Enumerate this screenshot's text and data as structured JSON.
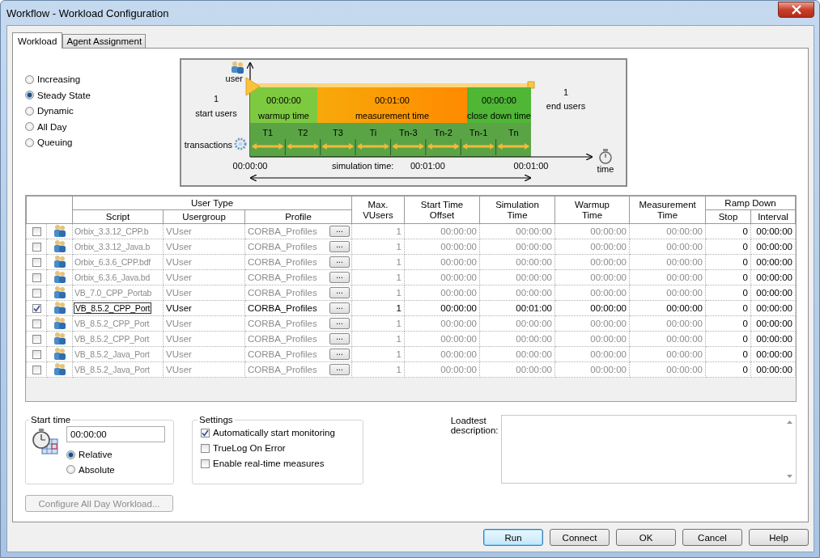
{
  "window": {
    "title": "Workflow - Workload Configuration"
  },
  "tabs": [
    {
      "label": "Workload",
      "selected": true
    },
    {
      "label": "Agent Assignment",
      "selected": false
    }
  ],
  "workload_types": [
    {
      "label": "Increasing",
      "selected": false
    },
    {
      "label": "Steady State",
      "selected": true
    },
    {
      "label": "Dynamic",
      "selected": false
    },
    {
      "label": "All Day",
      "selected": false
    },
    {
      "label": "Queuing",
      "selected": false
    }
  ],
  "diagram": {
    "user_label": "user",
    "start_users": "1",
    "start_users_label": "start users",
    "end_users": "1",
    "end_users_label": "end users",
    "phases": [
      {
        "kind": "warmup",
        "time": "00:00:00",
        "label": "warmup time"
      },
      {
        "kind": "measurement",
        "time": "00:01:00",
        "label": "measurement time"
      },
      {
        "kind": "closedown",
        "time": "00:00:00",
        "label": "close down time"
      }
    ],
    "transactions_label": "transactions",
    "transactions": [
      "T1",
      "T2",
      "T3",
      "Ti",
      "Tn-3",
      "Tn-2",
      "Tn-1",
      "Tn"
    ],
    "start_time": "00:00:00",
    "simulation_label": "simulation time:",
    "simulation_time": "00:01:00",
    "end_time": "00:01:00",
    "time_label": "time"
  },
  "table": {
    "user_type_header": "User Type",
    "user_type_columns": [
      "Script",
      "Usergroup",
      "Profile"
    ],
    "columns": [
      "Max. VUsers",
      "Start Time Offset",
      "Simulation Time",
      "Warmup Time",
      "Measurement Time"
    ],
    "ramp_down_header": "Ramp Down",
    "ramp_down_columns": [
      "Stop",
      "Interval"
    ],
    "rows": [
      {
        "checked": false,
        "selected": false,
        "script": "Orbix_3.3.12_CPP.b",
        "usergroup": "VUser",
        "profile": "CORBA_Profiles",
        "profile_button": "...",
        "values": [
          "1",
          "00:00:00",
          "00:00:00",
          "00:00:00",
          "00:00:00"
        ],
        "stop": "0",
        "interval": "00:00:00"
      },
      {
        "checked": false,
        "selected": false,
        "script": "Orbix_3.3.12_Java.b",
        "usergroup": "VUser",
        "profile": "CORBA_Profiles",
        "profile_button": "...",
        "values": [
          "1",
          "00:00:00",
          "00:00:00",
          "00:00:00",
          "00:00:00"
        ],
        "stop": "0",
        "interval": "00:00:00"
      },
      {
        "checked": false,
        "selected": false,
        "script": "Orbix_6.3.6_CPP.bdf",
        "usergroup": "VUser",
        "profile": "CORBA_Profiles",
        "profile_button": "...",
        "values": [
          "1",
          "00:00:00",
          "00:00:00",
          "00:00:00",
          "00:00:00"
        ],
        "stop": "0",
        "interval": "00:00:00"
      },
      {
        "checked": false,
        "selected": false,
        "script": "Orbix_6.3.6_Java.bd",
        "usergroup": "VUser",
        "profile": "CORBA_Profiles",
        "profile_button": "...",
        "values": [
          "1",
          "00:00:00",
          "00:00:00",
          "00:00:00",
          "00:00:00"
        ],
        "stop": "0",
        "interval": "00:00:00"
      },
      {
        "checked": false,
        "selected": false,
        "script": "VB_7.0_CPP_Portab",
        "usergroup": "VUser",
        "profile": "CORBA_Profiles",
        "profile_button": "...",
        "values": [
          "1",
          "00:00:00",
          "00:00:00",
          "00:00:00",
          "00:00:00"
        ],
        "stop": "0",
        "interval": "00:00:00"
      },
      {
        "checked": true,
        "selected": true,
        "script": "VB_8.5.2_CPP_Port",
        "usergroup": "VUser",
        "profile": "CORBA_Profiles",
        "profile_button": "...",
        "values": [
          "1",
          "00:00:00",
          "00:01:00",
          "00:00:00",
          "00:00:00"
        ],
        "stop": "0",
        "interval": "00:00:00"
      },
      {
        "checked": false,
        "selected": false,
        "script": "VB_8.5.2_CPP_Port",
        "usergroup": "VUser",
        "profile": "CORBA_Profiles",
        "profile_button": "...",
        "values": [
          "1",
          "00:00:00",
          "00:00:00",
          "00:00:00",
          "00:00:00"
        ],
        "stop": "0",
        "interval": "00:00:00"
      },
      {
        "checked": false,
        "selected": false,
        "script": "VB_8.5.2_CPP_Port",
        "usergroup": "VUser",
        "profile": "CORBA_Profiles",
        "profile_button": "...",
        "values": [
          "1",
          "00:00:00",
          "00:00:00",
          "00:00:00",
          "00:00:00"
        ],
        "stop": "0",
        "interval": "00:00:00"
      },
      {
        "checked": false,
        "selected": false,
        "script": "VB_8.5.2_Java_Port",
        "usergroup": "VUser",
        "profile": "CORBA_Profiles",
        "profile_button": "...",
        "values": [
          "1",
          "00:00:00",
          "00:00:00",
          "00:00:00",
          "00:00:00"
        ],
        "stop": "0",
        "interval": "00:00:00"
      },
      {
        "checked": false,
        "selected": false,
        "script": "VB_8.5.2_Java_Port",
        "usergroup": "VUser",
        "profile": "CORBA_Profiles",
        "profile_button": "...",
        "values": [
          "1",
          "00:00:00",
          "00:00:00",
          "00:00:00",
          "00:00:00"
        ],
        "stop": "0",
        "interval": "00:00:00"
      }
    ]
  },
  "start_time": {
    "title": "Start time",
    "value": "00:00:00",
    "options": [
      {
        "label": "Relative",
        "selected": true
      },
      {
        "label": "Absolute",
        "selected": false
      }
    ]
  },
  "settings": {
    "title": "Settings",
    "options": [
      {
        "label": "Automatically start monitoring",
        "checked": true
      },
      {
        "label": "TrueLog On Error",
        "checked": false
      },
      {
        "label": "Enable real-time measures",
        "checked": false
      }
    ]
  },
  "description": {
    "label": "Loadtest description:"
  },
  "configure_button": {
    "label": "Configure All Day Workload...",
    "disabled": true
  },
  "buttons": [
    {
      "label": "Run",
      "default": true
    },
    {
      "label": "Connect",
      "default": false
    },
    {
      "label": "OK",
      "default": false
    },
    {
      "label": "Cancel",
      "default": false
    },
    {
      "label": "Help",
      "default": false
    }
  ]
}
